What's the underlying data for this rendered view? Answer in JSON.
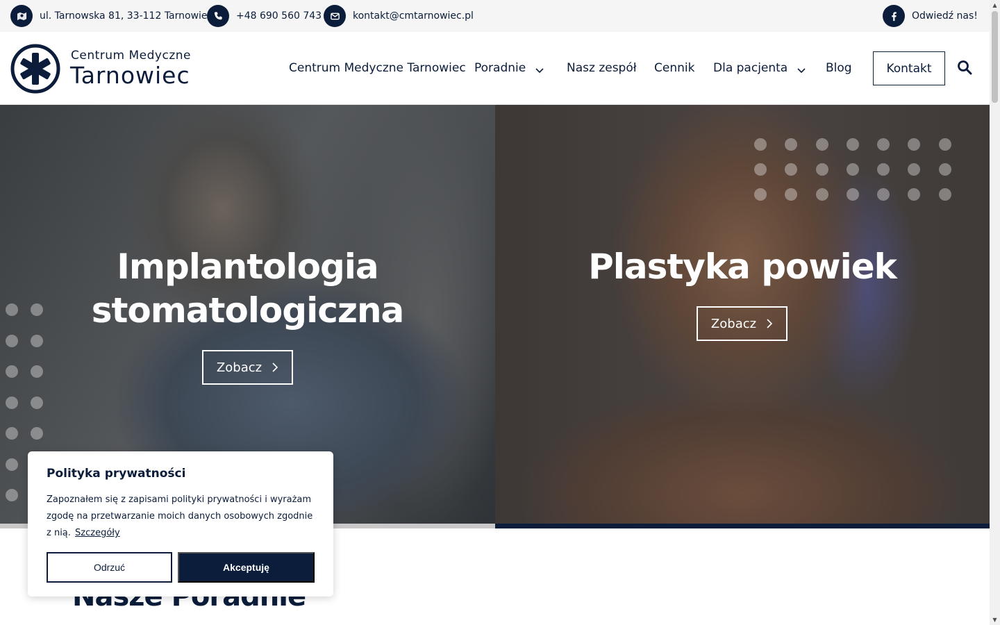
{
  "topbar": {
    "address": "ul. Tarnowska 81, 33-112 Tarnowiec",
    "phone": "+48 690 560 743",
    "email": "kontakt@cmtarnowiec.pl",
    "facebook_label": "Odwiedź nas!"
  },
  "logo": {
    "line1": "Centrum Medyczne",
    "line2": "Tarnowiec"
  },
  "nav": {
    "items": [
      {
        "label": "Centrum Medyczne Tarnowiec"
      },
      {
        "label": "Poradnie"
      },
      {
        "label": "Nasz zespół"
      },
      {
        "label": "Cennik"
      },
      {
        "label": "Dla pacjenta"
      },
      {
        "label": "Blog"
      }
    ],
    "contact_label": "Kontakt"
  },
  "hero": {
    "slides": [
      {
        "title_line1": "Implantologia",
        "title_line2": "stomatologiczna",
        "button": "Zobacz"
      },
      {
        "title_line1": "Plastyka powiek",
        "button": "Zobacz"
      }
    ]
  },
  "section": {
    "title": "Nasze Poradnie"
  },
  "cookie": {
    "title": "Polityka prywatności",
    "text": "Zapoznałem się z zapisami polityki prywatności i wyrażam zgodę na przetwarzanie moich danych osobowych zgodnie z nią.",
    "link": "Szczegóły",
    "reject": "Odrzuć",
    "accept": "Akceptuję"
  },
  "colors": {
    "brand": "#0b1d3a",
    "topbar_bg": "#f5f5f5"
  }
}
